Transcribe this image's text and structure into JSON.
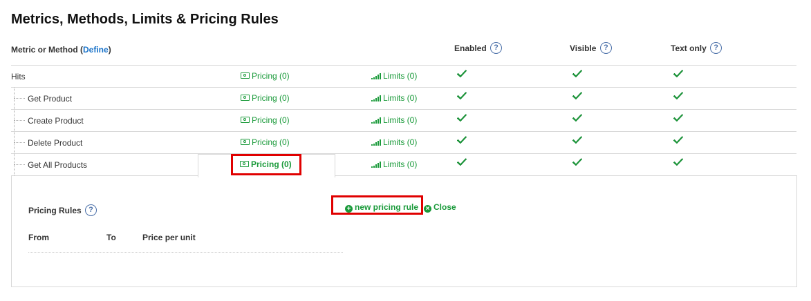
{
  "page": {
    "title": "Metrics, Methods, Limits & Pricing Rules"
  },
  "header": {
    "metric_label_pre": "Metric or Method (",
    "define_link": "Define",
    "metric_label_post": ")",
    "enabled": "Enabled",
    "visible": "Visible",
    "text_only": "Text only",
    "help": "?"
  },
  "rows": [
    {
      "name": "Hits",
      "pricing": "Pricing (0)",
      "limits": "Limits (0)"
    },
    {
      "name": "Get Product",
      "pricing": "Pricing (0)",
      "limits": "Limits (0)"
    },
    {
      "name": "Create Product",
      "pricing": "Pricing (0)",
      "limits": "Limits (0)"
    },
    {
      "name": "Delete Product",
      "pricing": "Pricing (0)",
      "limits": "Limits (0)"
    },
    {
      "name": "Get All Products",
      "pricing": "Pricing (0)",
      "limits": "Limits (0)"
    }
  ],
  "pricing_panel": {
    "title": "Pricing Rules",
    "help": "?",
    "new_rule": "new pricing rule",
    "close": "Close",
    "columns": [
      "From",
      "To",
      "Price per unit"
    ]
  },
  "colors": {
    "accent_green": "#1a9a3a",
    "link_blue": "#1a73c9",
    "highlight_red": "#e00000"
  },
  "icons": [
    "money-icon",
    "bars-icon",
    "checkmark-icon",
    "help-icon",
    "plus-circle-icon",
    "close-circle-icon"
  ]
}
